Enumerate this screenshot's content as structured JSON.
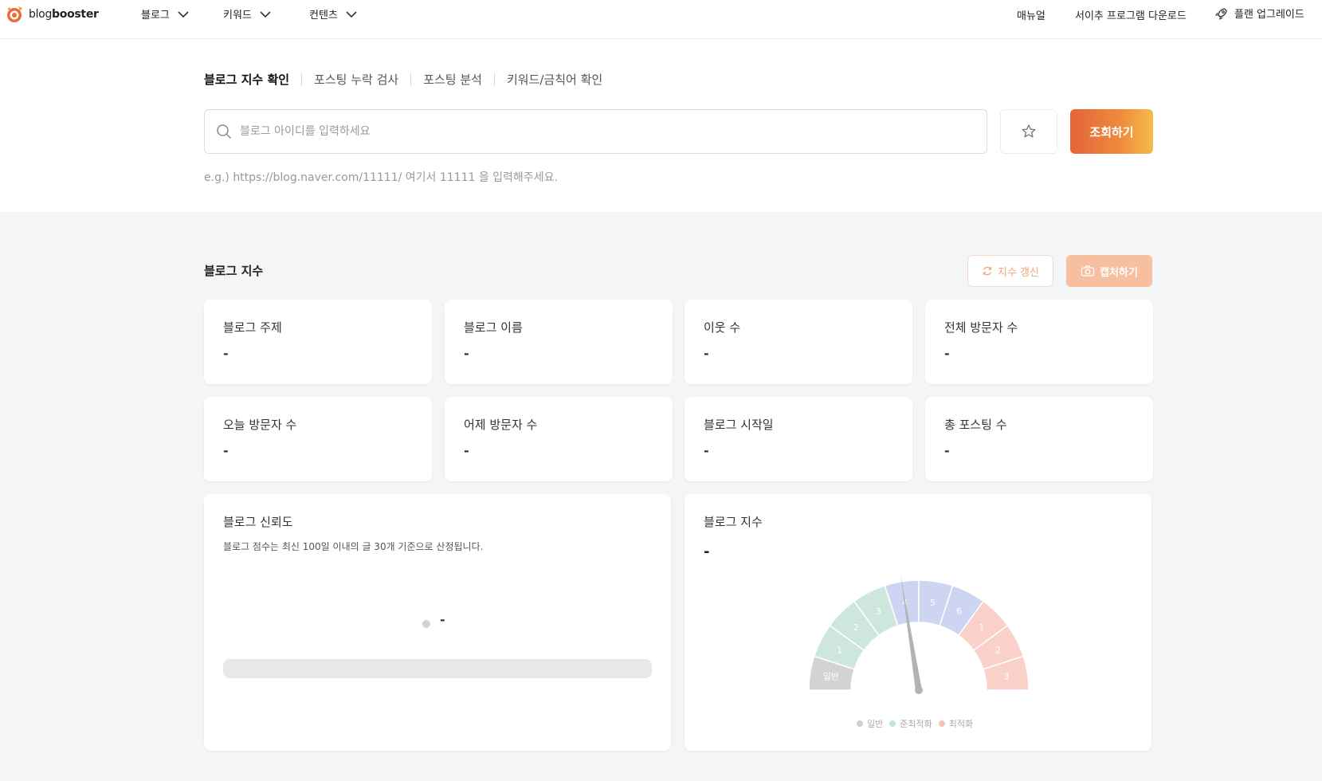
{
  "brand": {
    "prefix": "blog",
    "suffix": "booster"
  },
  "nav": {
    "menus": [
      {
        "label": "블로그"
      },
      {
        "label": "키워드"
      },
      {
        "label": "컨텐츠"
      }
    ],
    "right": {
      "manual": "매뉴얼",
      "download": "서이추 프로그램 다운로드",
      "upgrade": "플랜 업그레이드"
    }
  },
  "tabs": [
    "블로그 지수 확인",
    "포스팅 누락 검사",
    "포스팅 분석",
    "키워드/금칙어 확인"
  ],
  "search": {
    "placeholder": "블로그 아이디를 입력하세요",
    "value": "",
    "button": "조회하기",
    "hint": "e.g.) https://blog.naver.com/11111/ 여기서 11111 을 입력해주세요."
  },
  "section": {
    "title": "블로그 지수",
    "refresh": "지수 갱신",
    "capture": "캡처하기"
  },
  "stats": [
    {
      "label": "블로그 주제",
      "value": "-"
    },
    {
      "label": "블로그 이름",
      "value": "-"
    },
    {
      "label": "이웃 수",
      "value": "-"
    },
    {
      "label": "전체 방문자 수",
      "value": "-"
    },
    {
      "label": "오늘 방문자 수",
      "value": "-"
    },
    {
      "label": "어제 방문자 수",
      "value": "-"
    },
    {
      "label": "블로그 시작일",
      "value": "-"
    },
    {
      "label": "총 포스팅 수",
      "value": "-"
    }
  ],
  "trust": {
    "title": "블로그 신뢰도",
    "subtitle": "블로그 점수는 최신 100일 이내의 글 30개 기준으로 산정됩니다.",
    "value": "-",
    "progress": 0
  },
  "index": {
    "title": "블로그 지수",
    "value": "-",
    "gauge": {
      "segments": [
        "일반",
        "1",
        "2",
        "3",
        "4",
        "5",
        "6",
        "1",
        "2",
        "3"
      ],
      "needle_segment": 4.5,
      "colors": {
        "normal": "#d3d3d6",
        "semi": "#cde7dd",
        "mid": "#cdd5f3",
        "optimal": "#f9d1c8"
      }
    },
    "legend": [
      {
        "label": "일반",
        "color": "#cfcfd2"
      },
      {
        "label": "준최적화",
        "color": "#c5e4d8"
      },
      {
        "label": "최적화",
        "color": "#f7c3b8"
      }
    ]
  }
}
